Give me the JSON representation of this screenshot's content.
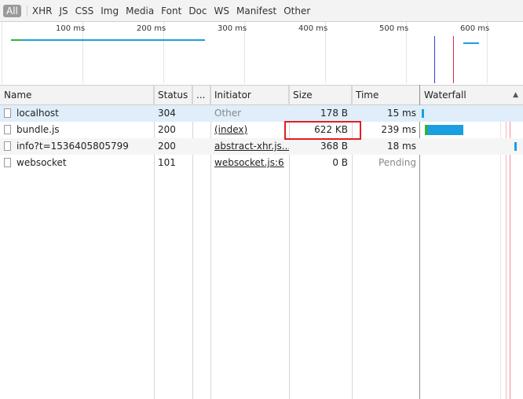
{
  "filters": {
    "all": "All",
    "types": [
      "XHR",
      "JS",
      "CSS",
      "Img",
      "Media",
      "Font",
      "Doc",
      "WS",
      "Manifest",
      "Other"
    ]
  },
  "overview": {
    "ticks": [
      "100 ms",
      "200 ms",
      "300 ms",
      "400 ms",
      "500 ms",
      "600 ms"
    ]
  },
  "columns": {
    "name": "Name",
    "status": "Status",
    "more": "...",
    "initiator": "Initiator",
    "size": "Size",
    "time": "Time",
    "waterfall": "Waterfall"
  },
  "rows": [
    {
      "name": "localhost",
      "status": "304",
      "initiator": "Other",
      "size": "178 B",
      "time": "15 ms"
    },
    {
      "name": "bundle.js",
      "status": "200",
      "initiator": "(index)",
      "size": "622 KB",
      "time": "239 ms"
    },
    {
      "name": "info?t=1536405805799",
      "status": "200",
      "initiator": "abstract-xhr.js...",
      "size": "368 B",
      "time": "18 ms"
    },
    {
      "name": "websocket",
      "status": "101",
      "initiator": "websocket.js:6",
      "size": "0 B",
      "time": "Pending"
    }
  ],
  "colors": {
    "waiting": "#2fb14a",
    "download": "#1a9fe0",
    "dom_content_loaded": "#2a3fd1",
    "load": "#e0263d",
    "highlight": "#e02020"
  }
}
